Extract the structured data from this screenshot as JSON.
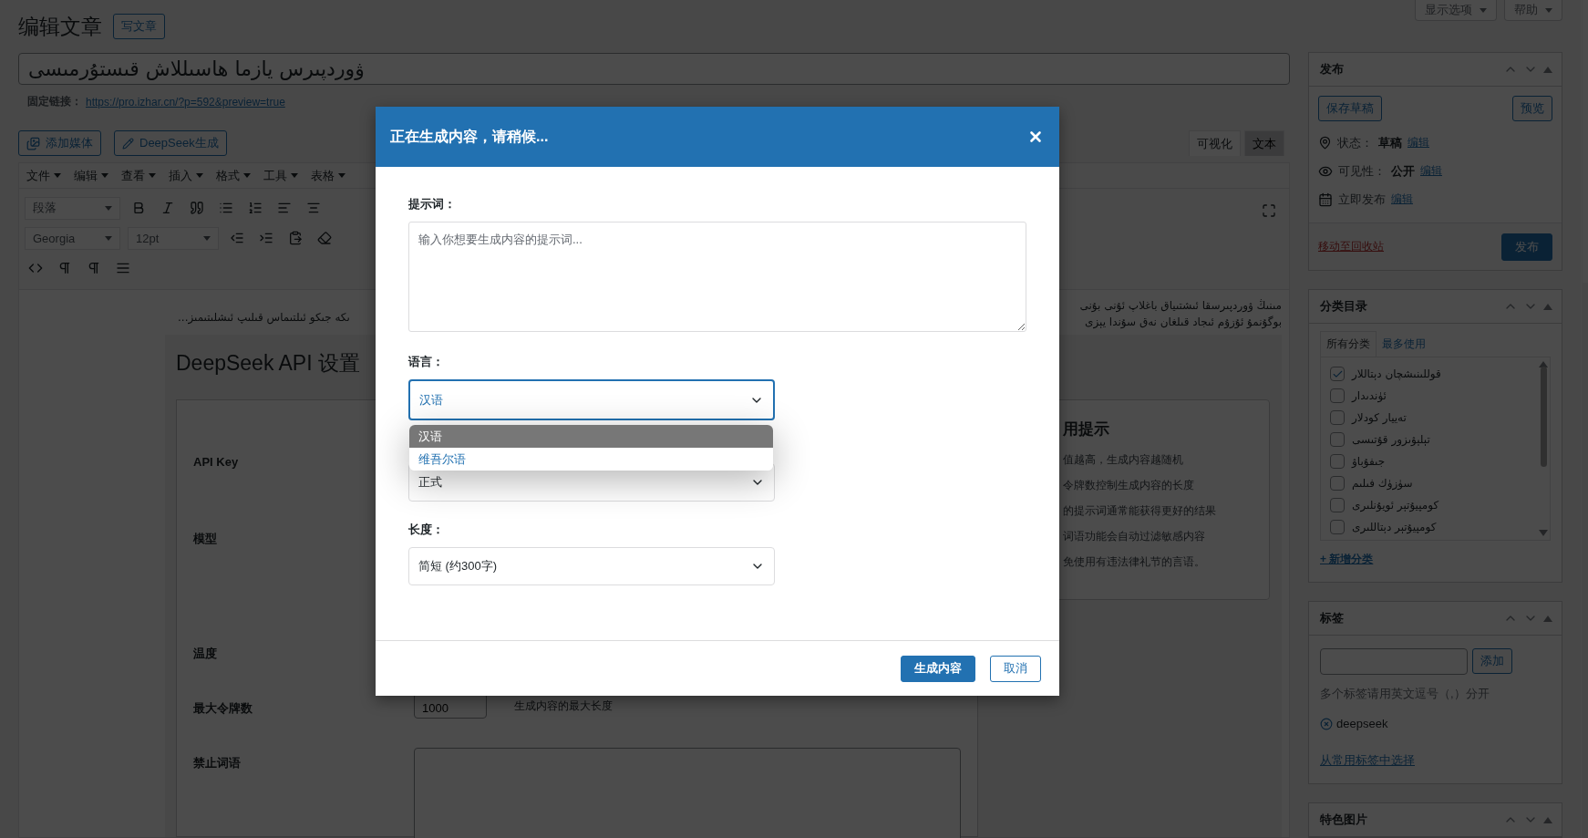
{
  "header": {
    "title": "编辑文章",
    "add_new": "写文章"
  },
  "screen_meta": [
    "显示选项",
    "帮助"
  ],
  "post_title": "ۋوردپىرس يازما ھاسىللاش قىستۇرمىسى",
  "permalink": {
    "label": "固定链接：",
    "url": "https://pro.izhar.cn/?p=592&preview=true"
  },
  "media_buttons": [
    {
      "label": "添加媒体",
      "kind": "media"
    },
    {
      "label": "DeepSeek生成",
      "kind": "pencil"
    }
  ],
  "editor_tabs": [
    {
      "label": "可视化",
      "selected": true
    },
    {
      "label": "文本",
      "selected": false
    }
  ],
  "menu": [
    "文件",
    "编辑",
    "查看",
    "插入",
    "格式",
    "工具",
    "表格"
  ],
  "toolbar": {
    "format": "段落",
    "font": "Georgia",
    "size": "12pt"
  },
  "content": {
    "right_lines": [
      "مىنىڭ ۋوردپىرسقا ئىشتىياق باغلاپ ئۇنى بۇنى",
      "بوگۇنمۇ ئۇزۇم ئىجاد قىلغان نەق سۇندا يېزى"
    ],
    "left_line": "ىكه جىكو ئىلتىماس قىلىپ ئىشلىتىمىز..."
  },
  "settings": {
    "title": "DeepSeek API 设置",
    "fields": [
      {
        "label": "API Key"
      },
      {
        "label": "模型"
      },
      {
        "label": "温度"
      },
      {
        "label": "最大令牌数"
      },
      {
        "label": "禁止词语"
      }
    ],
    "max_tokens": {
      "value": "1000",
      "hint": "生成内容的最大长度"
    },
    "tips": {
      "title": "用提示",
      "items": [
        "值越高，生成内容越随机",
        "令牌数控制生成内容的长度",
        "的提示词通常能获得更好的结果",
        "词语功能会自动过滤敏感内容",
        "免使用有违法律礼节的言语。"
      ]
    }
  },
  "publish": {
    "title": "发布",
    "save_draft": "保存草稿",
    "preview": "预览",
    "meta": [
      {
        "kind": "status",
        "label": "状态：",
        "value": "草稿",
        "link": "编辑"
      },
      {
        "kind": "visibility",
        "label": "可见性：",
        "value": "公开",
        "link": "编辑"
      },
      {
        "kind": "schedule",
        "label": "立即发布",
        "link": "编辑"
      }
    ],
    "trash": "移动至回收站",
    "publish": "发布"
  },
  "categories": {
    "title": "分类目录",
    "tabs": [
      {
        "label": "所有分类",
        "selected": true
      },
      {
        "label": "最多使用",
        "selected": false
      }
    ],
    "items": [
      {
        "label": "قوللىنىشچان دېتاللار",
        "checked": true
      },
      {
        "label": "ئۈندىدار",
        "checked": false
      },
      {
        "label": "تەييار كودلار",
        "checked": false
      },
      {
        "label": "تېلېۋىزور قۇتىسى",
        "checked": false
      },
      {
        "label": "جىفۇباۋ",
        "checked": false
      },
      {
        "label": "سۈزۈك فىلىم",
        "checked": false
      },
      {
        "label": "كومپيۇتېر ئويۇنلىرى",
        "checked": false
      },
      {
        "label": "كومپيۇتېر دېتاللىرى",
        "checked": false
      }
    ],
    "add": "+ 新增分类"
  },
  "tags": {
    "title": "标签",
    "add": "添加",
    "hint": "多个标签请用英文逗号（,）分开",
    "items": [
      "deepseek"
    ],
    "choose": "从常用标签中选择"
  },
  "featured_image": {
    "title": "特色图片"
  },
  "modal": {
    "title": "正在生成内容，请稍候...",
    "prompt_label": "提示词：",
    "prompt_placeholder": "输入你想要生成内容的提示词...",
    "language_label": "语言：",
    "language_value": "汉语",
    "language_options": [
      {
        "label": "汉语",
        "selected": true
      },
      {
        "label": "维吾尔语",
        "selected": false
      }
    ],
    "tone_value": "正式",
    "length_label": "长度：",
    "length_value": "简短 (约300字)",
    "buttons": [
      {
        "label": "生成内容",
        "kind": "primary"
      },
      {
        "label": "取消",
        "kind": "secondary"
      }
    ]
  }
}
